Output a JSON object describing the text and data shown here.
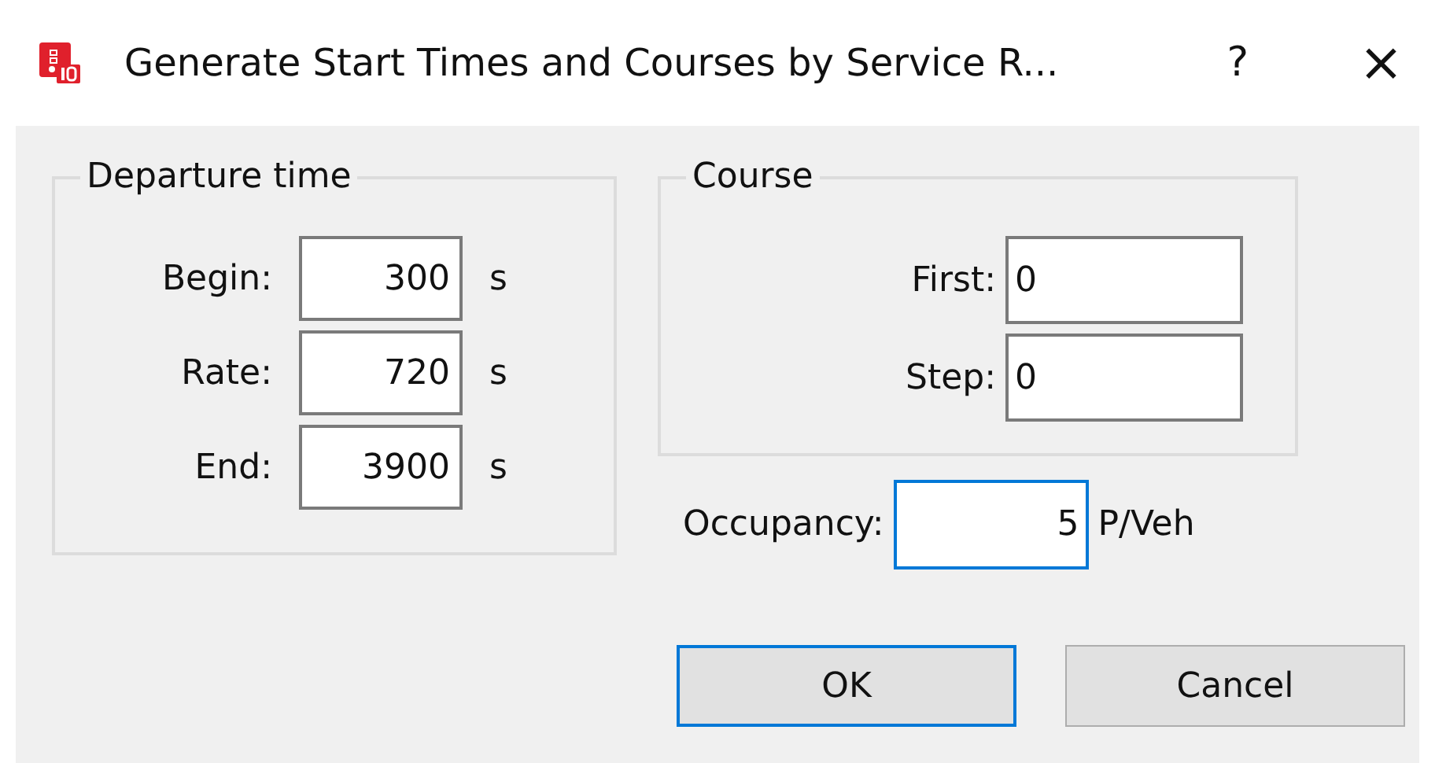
{
  "window": {
    "title": "Generate Start Times and Courses by Service R...",
    "help": "?",
    "close": "×"
  },
  "departure_time": {
    "title": "Departure time",
    "fields": [
      {
        "label": "Begin:",
        "value": "300",
        "unit": "s"
      },
      {
        "label": "Rate:",
        "value": "720",
        "unit": "s"
      },
      {
        "label": "End:",
        "value": "3900",
        "unit": "s"
      }
    ]
  },
  "course": {
    "title": "Course",
    "fields": [
      {
        "label": "First:",
        "value": "0"
      },
      {
        "label": "Step:",
        "value": "0"
      }
    ]
  },
  "occupancy": {
    "label": "Occupancy:",
    "value": "5",
    "unit": "P/Veh",
    "focused": true
  },
  "buttons": [
    {
      "label": "OK",
      "default": true
    },
    {
      "label": "Cancel",
      "default": false
    }
  ]
}
